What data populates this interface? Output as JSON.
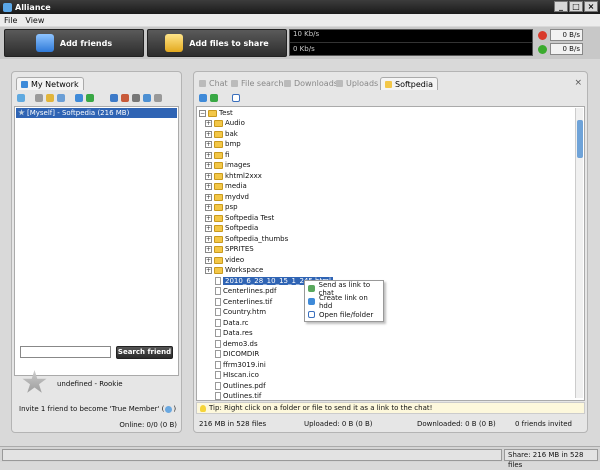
{
  "window": {
    "title": "Alliance",
    "minimize": "_",
    "maximize": "□",
    "close": "×"
  },
  "menu": {
    "file": "File",
    "view": "View"
  },
  "toolbar": {
    "add_friends": "Add friends",
    "add_files": "Add files to share",
    "graph_top": "10 Kb/s",
    "graph_bottom": "0 Kb/s",
    "upload_rate": "0 B/s",
    "download_rate": "0 B/s"
  },
  "left_panel": {
    "tab": "My Network",
    "selected_user": "[Myself] - Softpedia (216 MB)",
    "search_placeholder": "",
    "search_button": "Search friend",
    "user_status": "undefined  -  Rookie",
    "invite": "Invite 1 friend to become 'True Member' (",
    "invite_end": ")",
    "online": "Online: 0/0 (0 B)"
  },
  "right_panel": {
    "tabs": [
      "Chat",
      "File search",
      "Downloads",
      "Uploads",
      "Softpedia"
    ],
    "close": "×",
    "tree": {
      "root": "Test",
      "folders": [
        "Audio",
        "bak",
        "bmp",
        "fi",
        "images",
        "khtml2xxx",
        "media",
        "mydvd",
        "psp",
        "Softpedia Test",
        "Softpedia",
        "Softpedia_thumbs",
        "SPRITES",
        "video",
        "Workspace"
      ],
      "files": [
        "2010_6_28_10_15_1_245.html",
        "Centerlines.pdf",
        "Centerlines.tif",
        "Country.htm",
        "Data.rc",
        "Data.res",
        "demo3.ds",
        "DICOMDIR",
        "ffrm3019.ini",
        "HIscan.ico",
        "Outlines.pdf",
        "Outlines.tif"
      ]
    },
    "context_menu": [
      "Send as link to chat",
      "Create link on hdd",
      "Open file/folder"
    ],
    "tip": "Tip: Right click on a folder or file to send it as a link to the chat!",
    "stats_left": "216 MB in 528 files",
    "stats_uploaded": "Uploaded: 0 B (0 B)",
    "stats_downloaded": "Downloaded: 0 B (0 B)",
    "stats_invited": "0 friends invited"
  },
  "statusbar": {
    "share": "Share: 216 MB in 528 files"
  }
}
